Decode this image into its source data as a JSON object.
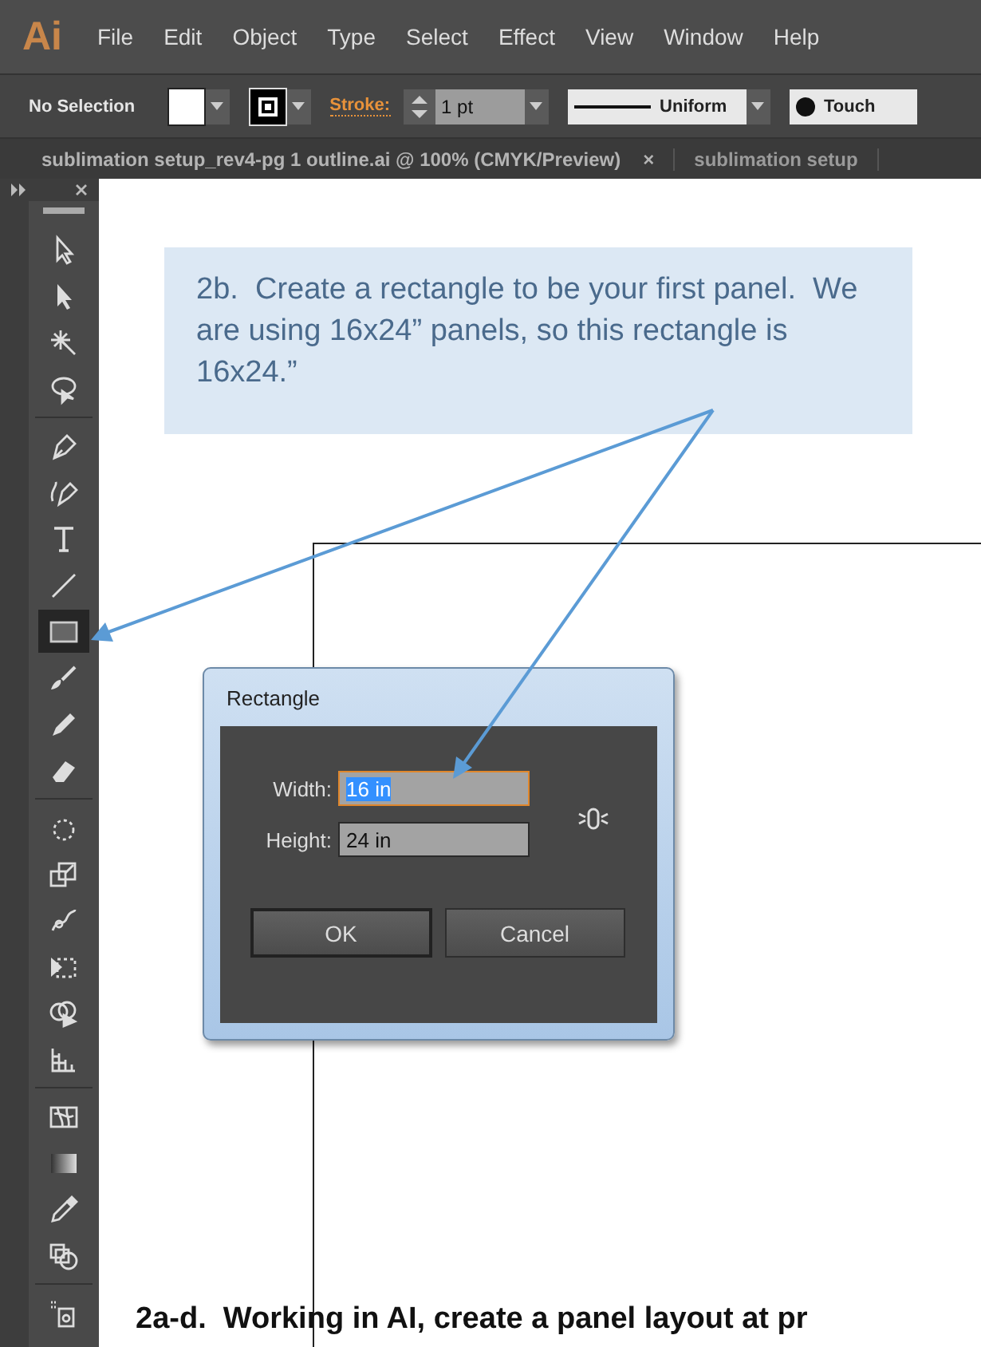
{
  "menu_bar": {
    "logo": "Ai",
    "items": [
      "File",
      "Edit",
      "Object",
      "Type",
      "Select",
      "Effect",
      "View",
      "Window",
      "Help"
    ]
  },
  "control_bar": {
    "selection": "No Selection",
    "stroke_label": "Stroke:",
    "stroke_weight": "1 pt",
    "profile": "Uniform",
    "brush": "Touch"
  },
  "document_tabs": [
    {
      "title": "sublimation setup_rev4-pg 1 outline.ai @ 100% (CMYK/Preview)",
      "selected": true,
      "close": "×"
    },
    {
      "title": "sublimation setup",
      "selected": false
    }
  ],
  "tools": [
    {
      "kind": "selection",
      "selected": false
    },
    {
      "kind": "direct",
      "selected": false
    },
    {
      "kind": "wand",
      "selected": false
    },
    {
      "kind": "lasso",
      "selected": false
    },
    {
      "kind": "pen",
      "selected": false
    },
    {
      "kind": "curvature",
      "selected": false
    },
    {
      "kind": "type",
      "selected": false
    },
    {
      "kind": "line",
      "selected": false
    },
    {
      "kind": "rectangle",
      "selected": true
    },
    {
      "kind": "brush",
      "selected": false
    },
    {
      "kind": "pencil",
      "selected": false
    },
    {
      "kind": "eraser",
      "selected": false
    },
    {
      "kind": "rotate",
      "selected": false
    },
    {
      "kind": "scale",
      "selected": false
    },
    {
      "kind": "warp",
      "selected": false
    },
    {
      "kind": "transform",
      "selected": false
    },
    {
      "kind": "builder",
      "selected": false
    },
    {
      "kind": "graph",
      "selected": false
    },
    {
      "kind": "mesh",
      "selected": false
    },
    {
      "kind": "gradient",
      "selected": false
    },
    {
      "kind": "eyedropper",
      "selected": false
    },
    {
      "kind": "blend",
      "selected": false
    },
    {
      "kind": "sprayer",
      "selected": false
    }
  ],
  "callout": {
    "text": "2b.  Create a rectangle to be your first panel.  We are using 16x24” panels, so this rectangle is 16x24.”"
  },
  "dialog": {
    "title": "Rectangle",
    "fields": [
      {
        "label": "Width:",
        "value": "16 in",
        "focused": true
      },
      {
        "label": "Height:",
        "value": "24 in",
        "focused": false
      }
    ],
    "buttons": [
      {
        "label": "OK",
        "default": true
      },
      {
        "label": "Cancel",
        "default": false
      }
    ]
  },
  "caption": "2a-d.  Working in AI, create a panel layout at pr"
}
